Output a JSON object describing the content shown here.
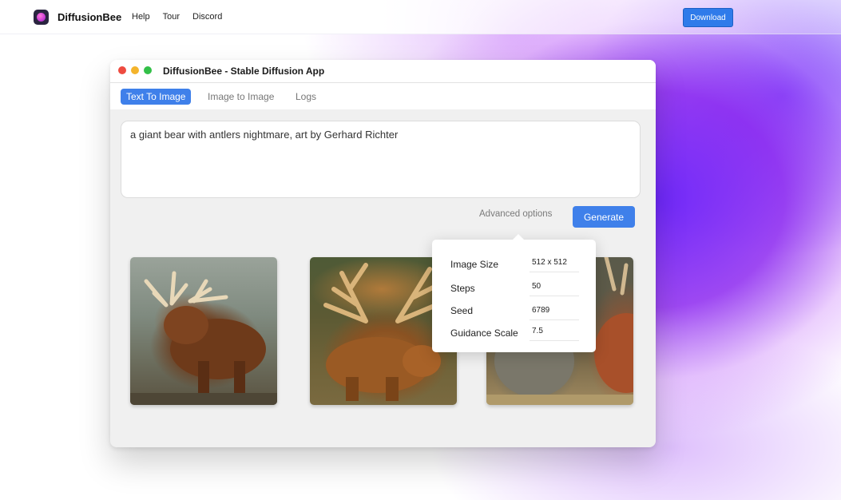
{
  "site": {
    "brand": "DiffusionBee",
    "nav": [
      "Help",
      "Tour",
      "Discord"
    ],
    "download_label": "Download"
  },
  "window": {
    "title": "DiffusionBee - Stable Diffusion App",
    "tabs": [
      {
        "label": "Text To Image",
        "active": true
      },
      {
        "label": "Image to Image",
        "active": false
      },
      {
        "label": "Logs",
        "active": false
      }
    ],
    "prompt": "a giant bear with antlers nightmare, art by Gerhard Richter",
    "advanced_label": "Advanced options",
    "generate_label": "Generate",
    "advanced": [
      {
        "label": "Image Size",
        "value": "512 x 512"
      },
      {
        "label": "Steps",
        "value": "50"
      },
      {
        "label": "Seed",
        "value": "6789"
      },
      {
        "label": "Guidance Scale",
        "value": "7.5"
      }
    ]
  },
  "colors": {
    "accent": "#3f80ea",
    "gradient_purple": "#7a2cf5"
  },
  "icons": {
    "brand_logo": "diffusionbee-logo-icon"
  }
}
